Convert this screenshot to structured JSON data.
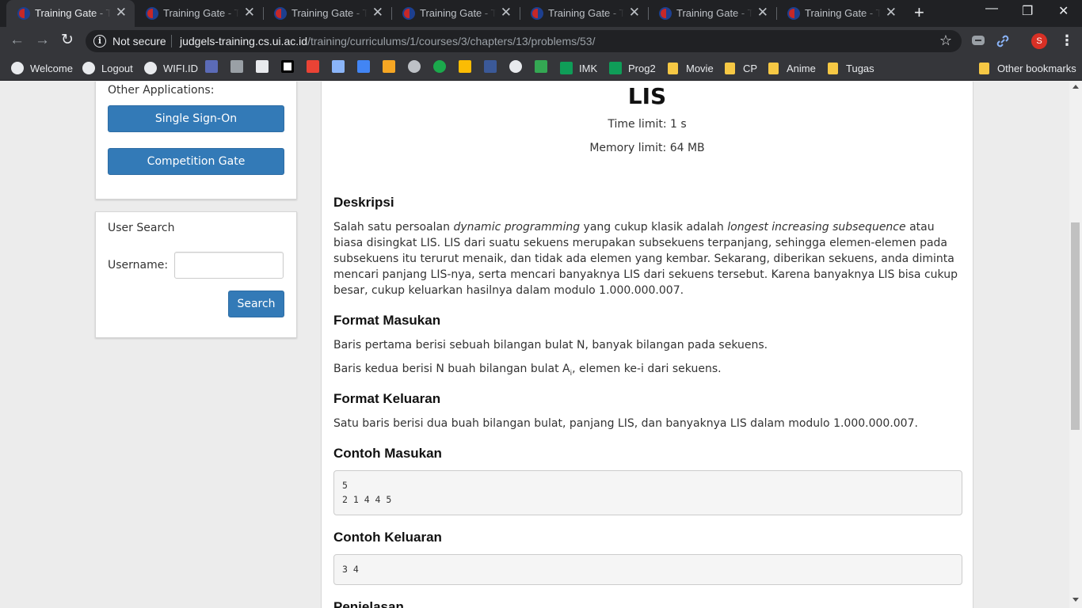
{
  "browser": {
    "tabs": [
      {
        "title": "Training Gate - Tra"
      },
      {
        "title": "Training Gate - Tra"
      },
      {
        "title": "Training Gate - Tra"
      },
      {
        "title": "Training Gate - Tra"
      },
      {
        "title": "Training Gate - Tra"
      },
      {
        "title": "Training Gate - Tra"
      },
      {
        "title": "Training Gate - Tra"
      }
    ],
    "tab_close": "✕",
    "new_tab": "+",
    "security": "Not secure",
    "url_host": "judgels-training.cs.ui.ac.id",
    "url_path": "/training/curriculums/1/courses/3/chapters/13/problems/53/",
    "avatar_letter": "S",
    "bookmarks": {
      "welcome": "Welcome",
      "logout": "Logout",
      "wifi": "WIFI.ID",
      "imk": "IMK",
      "prog2": "Prog2",
      "movie": "Movie",
      "cp": "CP",
      "anime": "Anime",
      "tugas": "Tugas",
      "other": "Other bookmarks"
    }
  },
  "sidebar": {
    "other_apps_label": "Other Applications:",
    "sso_button": "Single Sign-On",
    "competition_button": "Competition Gate",
    "user_search_title": "User Search",
    "username_label": "Username:",
    "username_value": "",
    "search_button": "Search"
  },
  "problem": {
    "title": "LIS",
    "time_limit": "Time limit: 1 s",
    "memory_limit": "Memory limit: 64 MB",
    "sections": {
      "description_title": "Deskripsi",
      "desc_part1": "Salah satu persoalan ",
      "desc_italic1": "dynamic programming",
      "desc_part2": " yang cukup klasik adalah ",
      "desc_italic2": "longest increasing subsequence",
      "desc_part3": " atau biasa disingkat LIS. LIS dari suatu sekuens merupakan subsekuens terpanjang, sehingga elemen-elemen pada subsekuens itu terurut menaik, dan tidak ada elemen yang kembar. Sekarang, diberikan sekuens, anda diminta mencari panjang LIS-nya, serta mencari banyaknya LIS dari sekuens tersebut. Karena banyaknya LIS bisa cukup besar, cukup keluarkan hasilnya dalam modulo 1.000.000.007.",
      "input_title": "Format Masukan",
      "input_line1": "Baris pertama berisi sebuah bilangan bulat N, banyak bilangan pada sekuens.",
      "input_line2_a": "Baris kedua berisi N buah bilangan bulat A",
      "input_line2_sub": "i",
      "input_line2_b": ", elemen ke-i dari sekuens.",
      "output_title": "Format Keluaran",
      "output_line": "Satu baris berisi dua buah bilangan bulat, panjang LIS, dan banyaknya LIS dalam modulo 1.000.000.007.",
      "sample_input_title": "Contoh Masukan",
      "sample_input": "5\n2 1 4 4 5",
      "sample_output_title": "Contoh Keluaran",
      "sample_output": "3 4",
      "explanation_title": "Penjelasan"
    }
  }
}
